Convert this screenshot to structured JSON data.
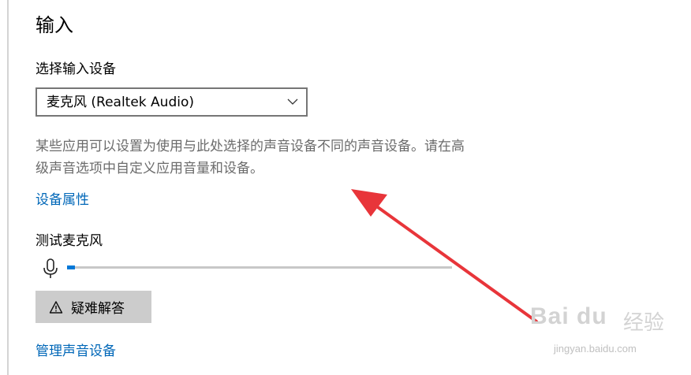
{
  "input_section": {
    "title": "输入",
    "select_device_label": "选择输入设备",
    "selected_device": "麦克风 (Realtek Audio)",
    "description": "某些应用可以设置为使用与此处选择的声音设备不同的声音设备。请在高级声音选项中自定义应用音量和设备。",
    "device_properties_link": "设备属性",
    "test_mic_label": "测试麦克风",
    "mic_level_fraction": 0.02,
    "troubleshoot_button": "疑难解答",
    "manage_devices_link": "管理声音设备"
  },
  "watermark": {
    "logo": "Bai du",
    "text": "经验",
    "url": "jingyan.baidu.com"
  },
  "colors": {
    "link": "#0067b8",
    "accent": "#0078d7",
    "annotation_arrow": "#e8353a",
    "button_bg": "#cccccc"
  },
  "icons": [
    "chevron-down-icon",
    "microphone-icon",
    "warning-icon",
    "annotation-arrow"
  ]
}
